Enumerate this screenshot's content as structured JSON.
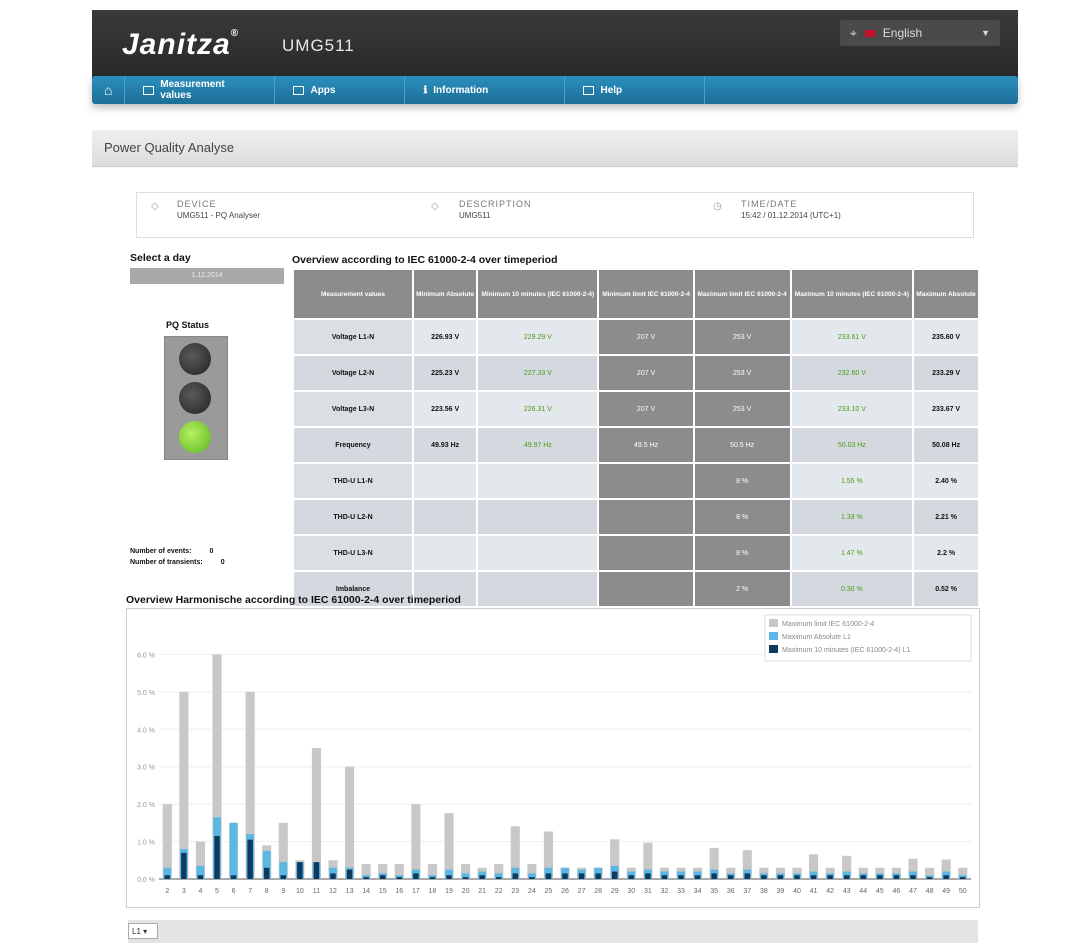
{
  "header": {
    "brand": "Janitza",
    "brand_mark": "®",
    "product": "UMG511",
    "language": "English",
    "flag_color": "#c8102e"
  },
  "nav": {
    "items": [
      {
        "label": "Measurement values"
      },
      {
        "label": "Apps"
      },
      {
        "label": "Information"
      },
      {
        "label": "Help"
      }
    ],
    "accent": "#2380ad"
  },
  "panel": {
    "title": "Power Quality Analyse"
  },
  "info": {
    "device_label": "DEVICE",
    "device_value": "UMG511 - PQ Analyser",
    "description_label": "DESCRIPTION",
    "description_value": "UMG511",
    "timedate_label": "TIME/DATE",
    "timedate_value": "15:42 / 01.12.2014 (UTC+1)"
  },
  "day": {
    "title": "Select a day",
    "button_label": "1.12.2014"
  },
  "pq": {
    "label": "PQ Status",
    "status": "green",
    "events_label": "Number of events:",
    "events_value": "0",
    "transients_label": "Number of transients:",
    "transients_value": "0"
  },
  "overview": {
    "title": "Overview according to IEC 61000-2-4 over timeperiod",
    "headers": [
      "Measurement values",
      "Minimum Absolute",
      "Minimum 10 minutes (IEC 61000-2-4)",
      "Minimum limit IEC 61000-2-4",
      "Maximum limit IEC 61000-2-4",
      "Maximum 10 minutes (IEC 61000-2-4)",
      "Maximum Absolute"
    ],
    "rows": [
      {
        "name": "Voltage L1-N",
        "min_abs": "226.93 V",
        "min_10": "229.29 V",
        "min_limit": "207 V",
        "max_limit": "253 V",
        "max_10": "233.61 V",
        "max_abs": "235.60 V"
      },
      {
        "name": "Voltage L2-N",
        "min_abs": "225.23 V",
        "min_10": "227.33 V",
        "min_limit": "207 V",
        "max_limit": "253 V",
        "max_10": "232.60 V",
        "max_abs": "233.29 V"
      },
      {
        "name": "Voltage L3-N",
        "min_abs": "223.56 V",
        "min_10": "226.31 V",
        "min_limit": "207 V",
        "max_limit": "253 V",
        "max_10": "233.10 V",
        "max_abs": "233.67 V"
      },
      {
        "name": "Frequency",
        "min_abs": "49.93 Hz",
        "min_10": "49.97 Hz",
        "min_limit": "49.5 Hz",
        "max_limit": "50.5 Hz",
        "max_10": "50.03 Hz",
        "max_abs": "50.08 Hz"
      },
      {
        "name": "THD-U L1-N",
        "min_abs": "",
        "min_10": "",
        "min_limit": "",
        "max_limit": "8 %",
        "max_10": "1.55 %",
        "max_abs": "2.40 %"
      },
      {
        "name": "THD-U L2-N",
        "min_abs": "",
        "min_10": "",
        "min_limit": "",
        "max_limit": "8 %",
        "max_10": "1.33 %",
        "max_abs": "2.21 %"
      },
      {
        "name": "THD-U L3-N",
        "min_abs": "",
        "min_10": "",
        "min_limit": "",
        "max_limit": "8 %",
        "max_10": "1.47 %",
        "max_abs": "2.2 %"
      },
      {
        "name": "Imbalance",
        "min_abs": "",
        "min_10": "",
        "min_limit": "",
        "max_limit": "2 %",
        "max_10": "0.30 %",
        "max_abs": "0.52 %"
      }
    ]
  },
  "harmonics": {
    "title": "Overview Harmonische according to IEC 61000-2-4 over timeperiod",
    "phase_select": "L1"
  },
  "chart_data": {
    "type": "bar",
    "title": "Overview Harmonische according to IEC 61000-2-4 over timeperiod",
    "xlabel": "",
    "ylabel": "",
    "ylim": [
      0,
      7
    ],
    "y_ticks": [
      "0.0 %",
      "1.0 %",
      "2.0 %",
      "3.0 %",
      "4.0 %",
      "5.0 %",
      "6.0 %"
    ],
    "legend_position": "top-right",
    "grid": true,
    "categories": [
      "2",
      "3",
      "4",
      "5",
      "6",
      "7",
      "8",
      "9",
      "10",
      "11",
      "12",
      "13",
      "14",
      "15",
      "16",
      "17",
      "18",
      "19",
      "20",
      "21",
      "22",
      "23",
      "24",
      "25",
      "26",
      "27",
      "28",
      "29",
      "30",
      "31",
      "32",
      "33",
      "34",
      "35",
      "36",
      "37",
      "38",
      "39",
      "40",
      "41",
      "42",
      "43",
      "44",
      "45",
      "46",
      "47",
      "48",
      "49",
      "50"
    ],
    "series": [
      {
        "name": "Maximum limit IEC 61000-2-4",
        "color": "#c8c8c8",
        "values": [
          2.0,
          5.0,
          1.0,
          6.0,
          1.5,
          5.0,
          0.9,
          1.5,
          0.5,
          3.5,
          0.5,
          3.0,
          0.4,
          0.4,
          0.4,
          2.0,
          0.4,
          1.76,
          0.4,
          0.3,
          0.4,
          1.41,
          0.4,
          1.27,
          0.3,
          0.3,
          0.3,
          1.06,
          0.3,
          0.97,
          0.3,
          0.3,
          0.3,
          0.83,
          0.3,
          0.77,
          0.3,
          0.3,
          0.3,
          0.66,
          0.3,
          0.62,
          0.3,
          0.3,
          0.3,
          0.54,
          0.3,
          0.52,
          0.3
        ]
      },
      {
        "name": "Maximum Absolute L1",
        "color": "#5bb8e4",
        "values": [
          0.3,
          0.8,
          0.35,
          1.65,
          1.5,
          1.2,
          0.75,
          0.45,
          0.45,
          0.45,
          0.3,
          0.3,
          0.1,
          0.15,
          0.1,
          0.25,
          0.1,
          0.25,
          0.15,
          0.2,
          0.15,
          0.3,
          0.15,
          0.3,
          0.3,
          0.25,
          0.3,
          0.35,
          0.2,
          0.25,
          0.2,
          0.2,
          0.2,
          0.25,
          0.15,
          0.25,
          0.15,
          0.15,
          0.15,
          0.2,
          0.15,
          0.2,
          0.15,
          0.15,
          0.15,
          0.2,
          0.1,
          0.2,
          0.1
        ]
      },
      {
        "name": "Maximum 10 minutes (IEC 61000-2-4) L1",
        "color": "#0e3a5e",
        "values": [
          0.1,
          0.7,
          0.1,
          1.15,
          0.1,
          1.05,
          0.3,
          0.1,
          0.45,
          0.45,
          0.15,
          0.25,
          0.05,
          0.1,
          0.05,
          0.15,
          0.05,
          0.1,
          0.05,
          0.1,
          0.05,
          0.15,
          0.05,
          0.15,
          0.15,
          0.15,
          0.15,
          0.2,
          0.1,
          0.15,
          0.1,
          0.1,
          0.1,
          0.15,
          0.1,
          0.15,
          0.1,
          0.1,
          0.1,
          0.1,
          0.1,
          0.1,
          0.1,
          0.1,
          0.1,
          0.1,
          0.05,
          0.1,
          0.05
        ]
      }
    ]
  }
}
